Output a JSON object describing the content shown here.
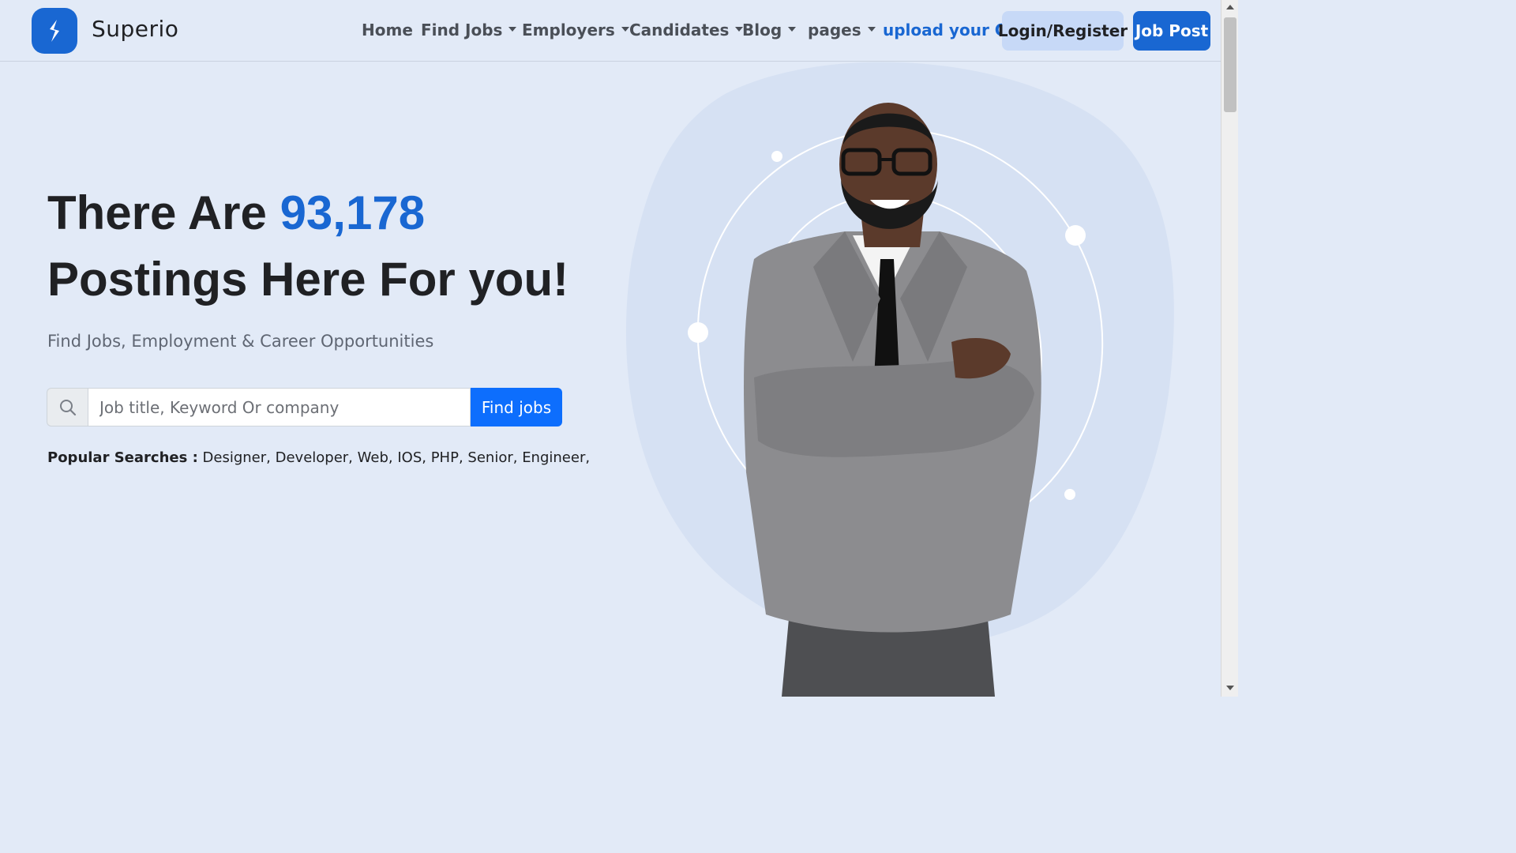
{
  "header": {
    "brand": "Superio",
    "nav": [
      {
        "label": "Home",
        "dropdown": false
      },
      {
        "label": "Find Jobs",
        "dropdown": true
      },
      {
        "label": "Employers",
        "dropdown": true
      },
      {
        "label": "Candidates",
        "dropdown": true
      },
      {
        "label": "Blog",
        "dropdown": true
      },
      {
        "label": "pages",
        "dropdown": true
      }
    ],
    "upload_cv": "upload your CV",
    "login": "Login/Register",
    "job_post": "Job Post"
  },
  "hero": {
    "title_prefix": "There Are ",
    "count": "93,178",
    "title_suffix": "Postings Here For you!",
    "subtitle": "Find Jobs, Employment & Career Opportunities",
    "search": {
      "placeholder": "Job title, Keyword Or company",
      "button": "Find jobs"
    },
    "popular_label": "Popular Searches :",
    "popular_tags": [
      "Designer,",
      "Developer,",
      "Web,",
      "IOS,",
      "PHP,",
      "Senior,",
      "Engineer,"
    ]
  },
  "colors": {
    "accent": "#1967d2",
    "button": "#0d6efd",
    "background": "#e2eaf7"
  }
}
